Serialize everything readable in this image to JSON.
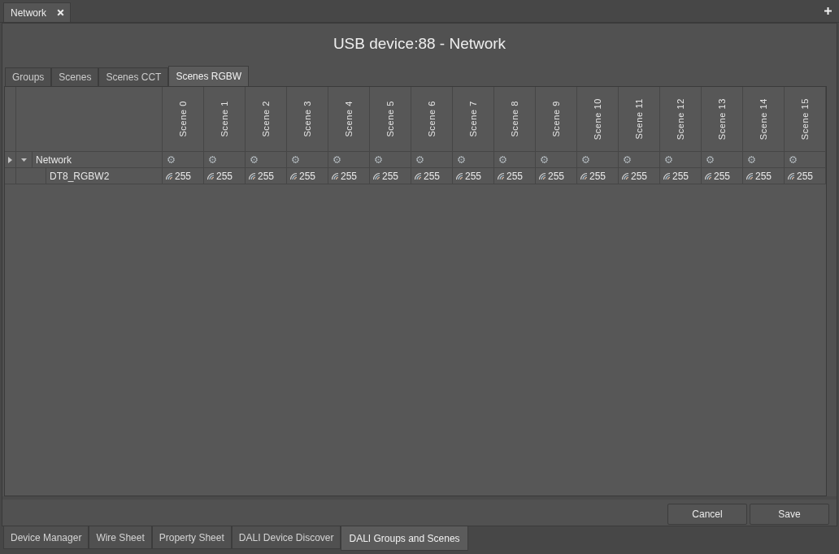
{
  "document_tabs": [
    {
      "label": "Network",
      "selected": true
    }
  ],
  "title": "USB device:88 - Network",
  "view_tabs": [
    {
      "label": "Groups",
      "selected": false
    },
    {
      "label": "Scenes",
      "selected": false
    },
    {
      "label": "Scenes CCT",
      "selected": false
    },
    {
      "label": "Scenes RGBW",
      "selected": true
    }
  ],
  "table": {
    "columns": [
      "Scene 0",
      "Scene 1",
      "Scene 2",
      "Scene 3",
      "Scene 4",
      "Scene 5",
      "Scene 6",
      "Scene 7",
      "Scene 8",
      "Scene 9",
      "Scene 10",
      "Scene 11",
      "Scene 12",
      "Scene 13",
      "Scene 14",
      "Scene 15"
    ],
    "rows": [
      {
        "name": "Network",
        "kind": "group",
        "selected": true,
        "expanded": true,
        "children": [
          {
            "name": "DT8_RGBW2",
            "kind": "device",
            "selected": false,
            "cells": [
              "255",
              "255",
              "255",
              "255",
              "255",
              "255",
              "255",
              "255",
              "255",
              "255",
              "255",
              "255",
              "255",
              "255",
              "255",
              "255"
            ]
          }
        ]
      }
    ]
  },
  "buttons": [
    "Cancel",
    "Save"
  ],
  "bottom_tabs": [
    {
      "label": "Device Manager",
      "selected": false
    },
    {
      "label": "Wire Sheet",
      "selected": false
    },
    {
      "label": "Property Sheet",
      "selected": false
    },
    {
      "label": "DALI Device Discover",
      "selected": false
    },
    {
      "label": "DALI Groups and Scenes",
      "selected": true
    }
  ]
}
